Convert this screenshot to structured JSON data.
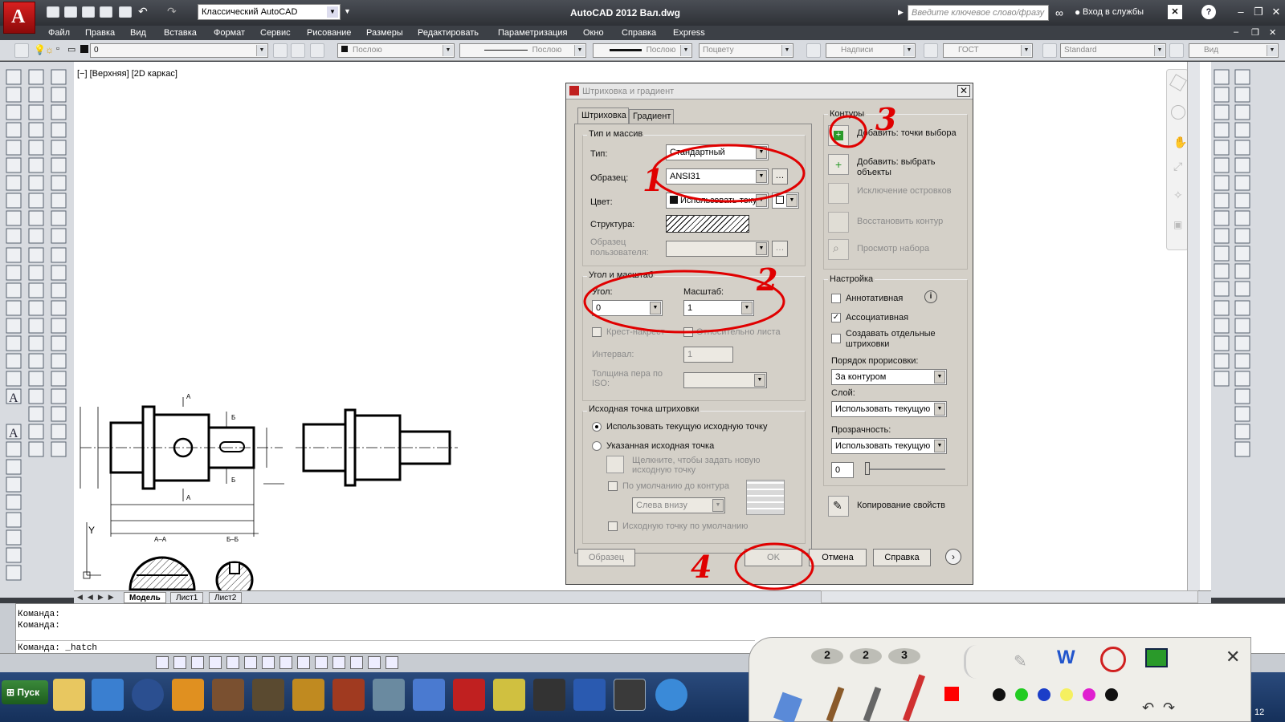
{
  "app": {
    "title": "AutoCAD 2012  Вал.dwg",
    "workspace": "Классический AutoCAD",
    "search_placeholder": "Введите ключевое слово/фразу",
    "login": "Вход в службы"
  },
  "menu": [
    "Файл",
    "Правка",
    "Вид",
    "Вставка",
    "Формат",
    "Сервис",
    "Рисование",
    "Размеры",
    "Редактировать",
    "Параметризация",
    "Окно",
    "Справка",
    "Express"
  ],
  "toolbar": {
    "layer": "0",
    "color": "Послою",
    "linetype": "Послою",
    "lineweight": "Послою",
    "plotstyle": "Поцвету",
    "textstyle": "Надписи",
    "dimstyle": "ГОСТ",
    "tablestyle": "Standard",
    "mleader": "Вид"
  },
  "viewport": {
    "label": "[−] [Верхняя] [2D каркас]"
  },
  "layout_tabs": [
    "Модель",
    "Лист1",
    "Лист2"
  ],
  "commands": [
    "Команда:",
    "Команда:",
    "Команда:  _hatch"
  ],
  "taskbar": {
    "start": "Пуск",
    "clock": "12"
  },
  "palette": {
    "counts": [
      "2",
      "2",
      "3"
    ],
    "colors": [
      "#111111",
      "#22cc22",
      "#1b3ec8",
      "#f5f060",
      "#e020d0",
      "#111111"
    ]
  },
  "drawing": {
    "section_a": "А–А",
    "section_b": "Б–Б",
    "axis_y": "Y",
    "mark_a": "А",
    "mark_b": "Б"
  },
  "dialog": {
    "title": "Штриховка и градиент",
    "tabs": [
      "Штриховка",
      "Градиент"
    ],
    "type_group": "Тип и массив",
    "type_label": "Тип:",
    "type_value": "Стандартный",
    "pattern_label": "Образец:",
    "pattern_value": "ANSI31",
    "color_label": "Цвет:",
    "color_value": "Использовать текущ",
    "swatch_label": "Структура:",
    "custom_label": "Образец пользователя:",
    "angle_group": "Угол и масштаб",
    "angle_label": "Угол:",
    "angle_value": "0",
    "scale_label": "Масштаб:",
    "scale_value": "1",
    "double_label": "Крест-накрест",
    "relative_label": "Относительно листа",
    "spacing_label": "Интервал:",
    "spacing_value": "1",
    "iso_label": "Толщина пера по ISO:",
    "origin_group": "Исходная точка штриховки",
    "origin_current": "Использовать текущую исходную точку",
    "origin_specified": "Указанная исходная точка",
    "click_label": "Щелкните, чтобы задать новую исходную точку",
    "default_bounds": "По умолчанию до контура",
    "corner_value": "Слева внизу",
    "store_default": "Исходную точку по умолчанию",
    "boundaries_group": "Контуры",
    "add_pick": "Добавить: точки выбора",
    "add_select": "Добавить: выбрать объекты",
    "remove_islands": "Исключение островков",
    "recreate": "Восстановить контур",
    "view_sel": "Просмотр набора",
    "options_group": "Настройка",
    "annotative": "Аннотативная",
    "associative": "Ассоциативная",
    "separate": "Создавать отдельные штриховки",
    "draw_order_label": "Порядок прорисовки:",
    "draw_order_value": "За контуром",
    "layer_label": "Слой:",
    "layer_value": "Использовать текущую",
    "transparency_label": "Прозрачность:",
    "transparency_value": "Использовать текущую",
    "transparency_num": "0",
    "inherit": "Копирование свойств",
    "preview": "Образец",
    "ok": "OK",
    "cancel": "Отмена",
    "help": "Справка"
  },
  "annotations": [
    "1",
    "2",
    "3",
    "4"
  ]
}
